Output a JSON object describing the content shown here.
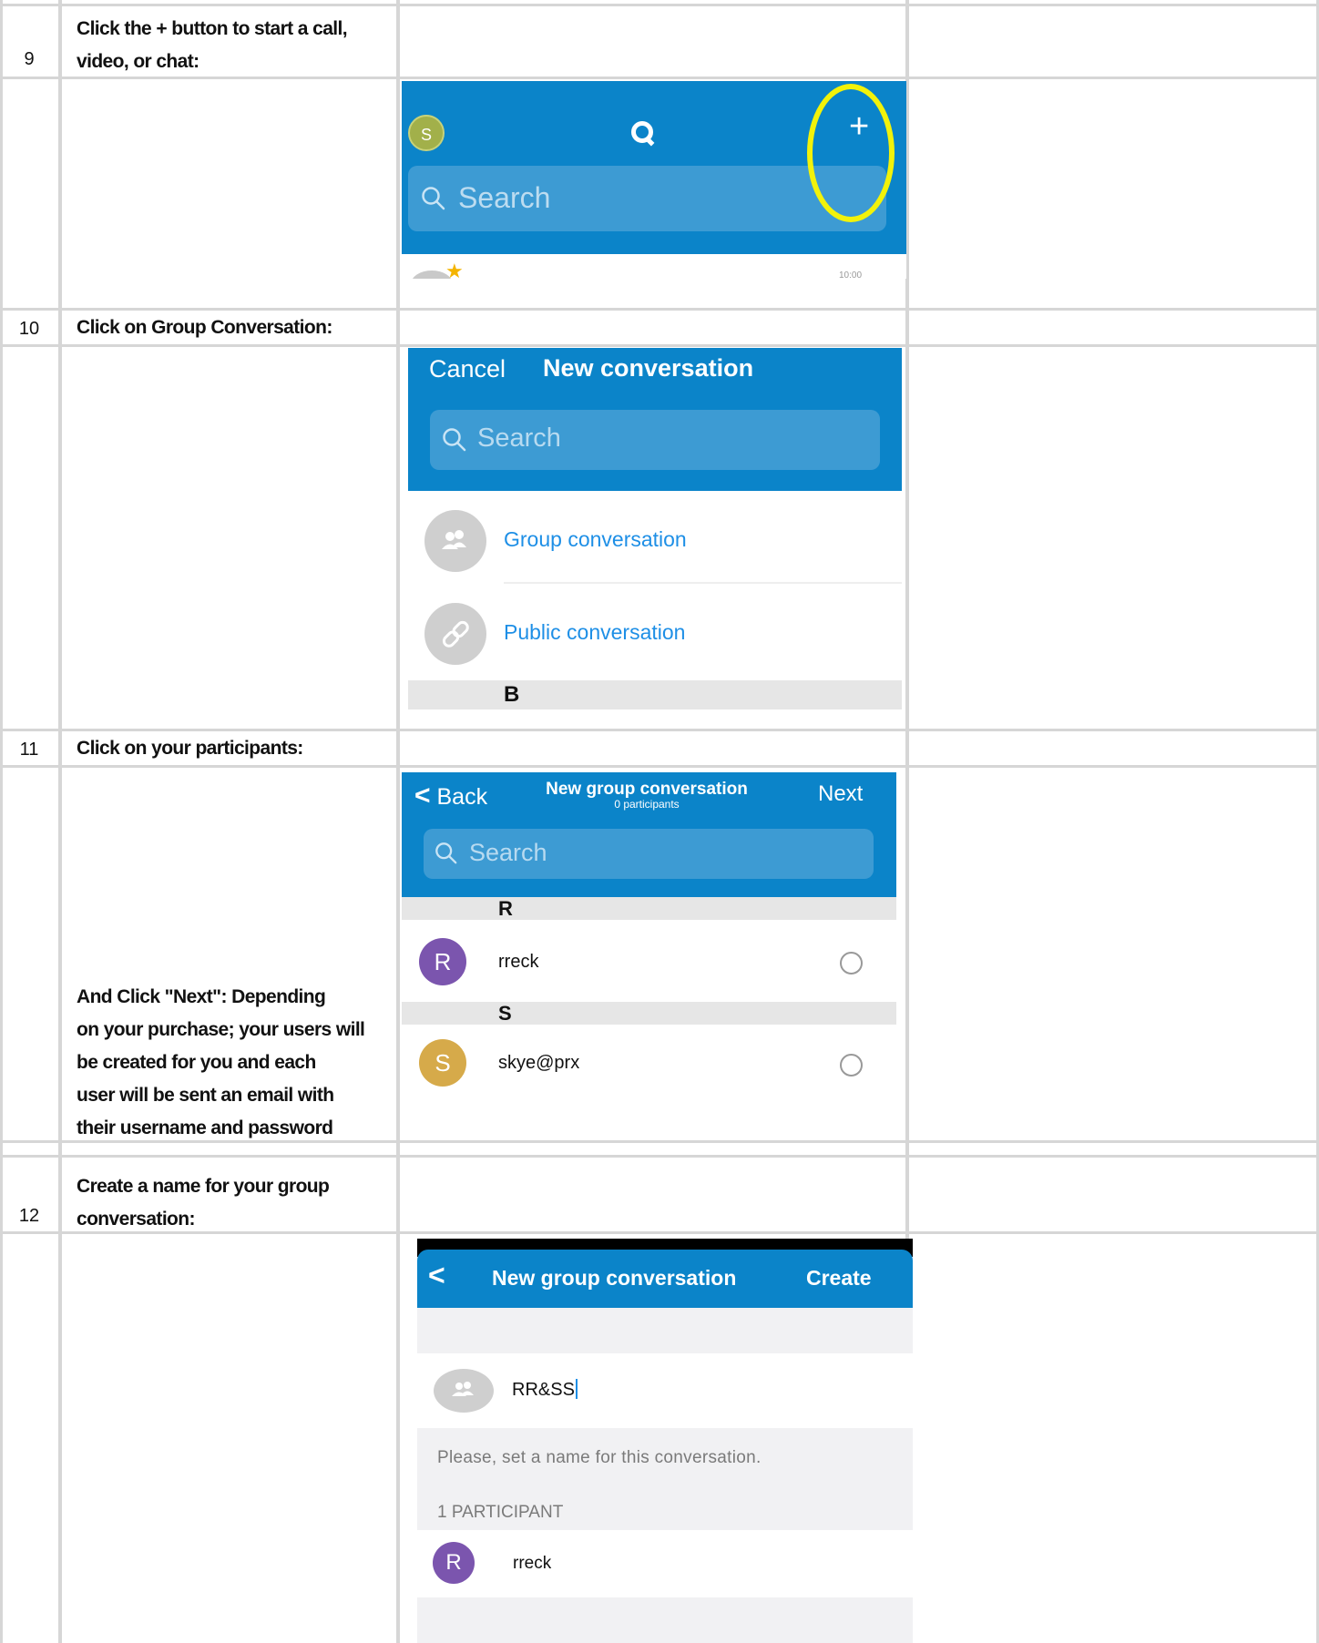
{
  "rows": [
    {
      "number": "9",
      "instruction": [
        "Click the + button to start a call,",
        "video, or chat:"
      ]
    },
    {
      "number": "10",
      "instruction": [
        "Click on Group Conversation:"
      ]
    },
    {
      "number": "11",
      "instruction": [
        "Click on your participants:"
      ]
    },
    {
      "note": [
        "And Click \"Next\": Depending",
        "on your purchase; your users will",
        "be created for you and each",
        "user will be sent an email with",
        "their username and password"
      ]
    },
    {
      "number": "12",
      "instruction": [
        "Create a name for your group",
        "conversation:"
      ]
    }
  ],
  "shot1": {
    "avatar_letter": "S",
    "search_placeholder": "Search",
    "plus_label": "+",
    "peek_time": "10:00"
  },
  "shot2": {
    "cancel": "Cancel",
    "title": "New conversation",
    "search_placeholder": "Search",
    "items": [
      {
        "label": "Group conversation",
        "icon": "group-icon"
      },
      {
        "label": "Public conversation",
        "icon": "link-icon"
      }
    ],
    "section": "B"
  },
  "shot3": {
    "back": "Back",
    "title": "New group conversation",
    "subtitle": "0 participants",
    "next": "Next",
    "search_placeholder": "Search",
    "sections": [
      {
        "letter": "R",
        "user": {
          "initial": "R",
          "name": "rreck",
          "color": "#7b55ae"
        }
      },
      {
        "letter": "S",
        "user": {
          "initial": "S",
          "name": "skye@prx",
          "color": "#d6aa4a"
        }
      }
    ]
  },
  "shot4": {
    "title": "New group conversation",
    "create": "Create",
    "name_value": "RR&SS",
    "hint": "Please, set a name for this conversation.",
    "participants_header": "1 PARTICIPANT",
    "participant": {
      "initial": "R",
      "name": "rreck",
      "color": "#7b55ae"
    }
  },
  "colors": {
    "header_blue": "#0b84c9",
    "highlight_yellow": "#f2f20a",
    "link_blue": "#1e8fe6"
  }
}
